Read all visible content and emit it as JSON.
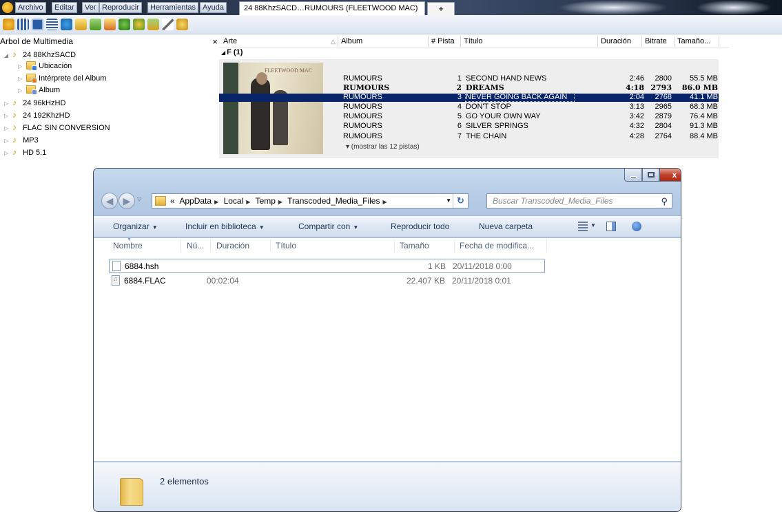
{
  "menubar": {
    "menus": [
      "Archivo",
      "Editar",
      "Ver",
      "Reproducir",
      "Herramientas",
      "Ayuda"
    ],
    "tab_title": "24 88KhzSACD…RUMOURS (FLEETWOOD MAC)",
    "new_tab": "+"
  },
  "tree": {
    "title": "Arbol de Multimedia",
    "close": "×",
    "nodes": [
      {
        "label": "24 88KhzSACD",
        "arrow": "◢"
      },
      {
        "label": "Ubicación",
        "arrow": "▷"
      },
      {
        "label": "Intérprete del Album",
        "arrow": "▷"
      },
      {
        "label": "Album",
        "arrow": "▷"
      },
      {
        "label": "24 96kHzHD",
        "arrow": "▷"
      },
      {
        "label": "24 192KhzHD",
        "arrow": "▷"
      },
      {
        "label": "FLAC SIN CONVERSION",
        "arrow": "▷"
      },
      {
        "label": "MP3",
        "arrow": "▷"
      },
      {
        "label": "HD 5.1",
        "arrow": "▷"
      }
    ]
  },
  "columns": {
    "arte": "Arte",
    "album": "Album",
    "pista": "# Pista",
    "titulo": "Título",
    "duracion": "Duración",
    "bitrate": "Bitrate",
    "tamano": "Tamaño..."
  },
  "group": {
    "label": "F (1)",
    "tri": "◢",
    "cover_brand": "FLEETWOOD MAC",
    "more": "▾ (mostrar las 12 pistas)"
  },
  "tracks": [
    {
      "album": "RUMOURS",
      "num": "1",
      "title": "SECOND HAND NEWS",
      "dur": "2:46",
      "bitrate": "2800",
      "size": "55.5 MB"
    },
    {
      "album": "RUMOURS",
      "num": "2",
      "title": "DREAMS",
      "dur": "4:18",
      "bitrate": "2793",
      "size": "86.0 MB"
    },
    {
      "album": "RUMOURS",
      "num": "3",
      "title": "NEVER GOING BACK AGAIN",
      "dur": "2:04",
      "bitrate": "2768",
      "size": "41.1 MB"
    },
    {
      "album": "RUMOURS",
      "num": "4",
      "title": "DON'T STOP",
      "dur": "3:13",
      "bitrate": "2965",
      "size": "68.3 MB"
    },
    {
      "album": "RUMOURS",
      "num": "5",
      "title": "GO YOUR OWN WAY",
      "dur": "3:42",
      "bitrate": "2879",
      "size": "76.4 MB"
    },
    {
      "album": "RUMOURS",
      "num": "6",
      "title": "SILVER SPRINGS",
      "dur": "4:32",
      "bitrate": "2804",
      "size": "91.3 MB"
    },
    {
      "album": "RUMOURS",
      "num": "7",
      "title": "THE CHAIN",
      "dur": "4:28",
      "bitrate": "2764",
      "size": "88.4 MB"
    }
  ],
  "explorer": {
    "close_label": "x",
    "address": {
      "lead": "«",
      "crumbs": [
        "AppData",
        "Local",
        "Temp",
        "Transcoded_Media_Files"
      ]
    },
    "search_placeholder": "Buscar Transcoded_Media_Files",
    "commands": {
      "organizar": "Organizar",
      "incluir": "Incluir en biblioteca",
      "compartir": "Compartir con",
      "reproducir": "Reproducir todo",
      "nueva": "Nueva carpeta"
    },
    "headers": {
      "nombre": "Nombre",
      "num": "Nú...",
      "duracion": "Duración",
      "titulo": "Título",
      "tamano": "Tamaño",
      "fecha": "Fecha de modifica..."
    },
    "files": [
      {
        "name": "6884.hsh",
        "duration": "",
        "size": "1 KB",
        "date": "20/11/2018 0:00"
      },
      {
        "name": "6884.FLAC",
        "duration": "00:02:04",
        "size": "22.407 KB",
        "date": "20/11/2018 0:01"
      }
    ],
    "status": "2 elementos"
  },
  "colors": {
    "selection": "#0a246a",
    "window_frame": "#b7cde6"
  }
}
